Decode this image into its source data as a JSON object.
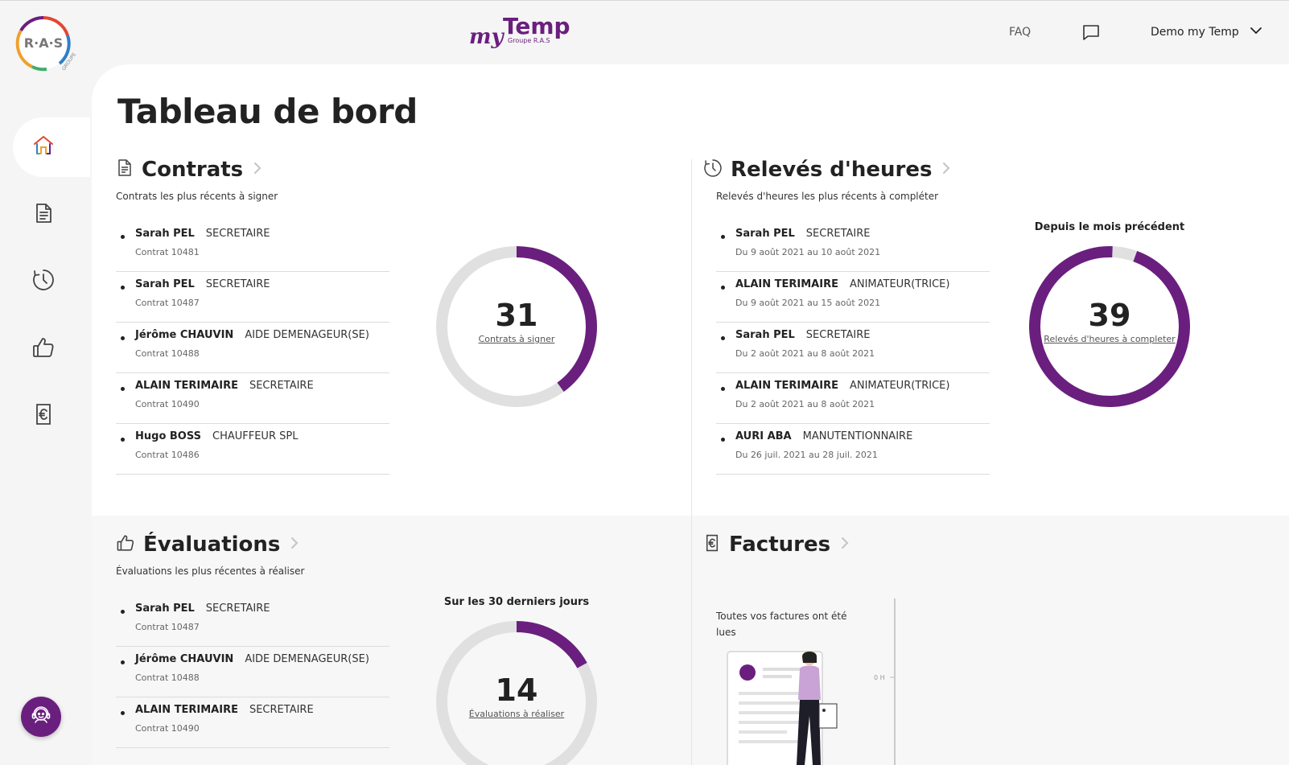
{
  "brand": {
    "logo_text": "R·A·S",
    "logo_sub": "GROUPE",
    "app_name_script": "my",
    "app_name": "Temp",
    "app_sub": "Groupe R.A.S"
  },
  "header": {
    "faq": "FAQ",
    "user": "Demo my Temp"
  },
  "page_title": "Tableau de bord",
  "contrats": {
    "title": "Contrats",
    "subtitle": "Contrats les plus récents à signer",
    "count": "31",
    "count_label": "Contrats à signer",
    "ratio": 0.4,
    "items": [
      {
        "name": "Sarah PEL",
        "job": "SECRETAIRE",
        "detail": "Contrat 10481"
      },
      {
        "name": "Sarah PEL",
        "job": "SECRETAIRE",
        "detail": "Contrat 10487"
      },
      {
        "name": "Jérôme CHAUVIN",
        "job": "AIDE DEMENAGEUR(SE)",
        "detail": "Contrat 10488"
      },
      {
        "name": "ALAIN TERIMAIRE",
        "job": "SECRETAIRE",
        "detail": "Contrat 10490"
      },
      {
        "name": "Hugo BOSS",
        "job": "CHAUFFEUR SPL",
        "detail": "Contrat 10486"
      }
    ]
  },
  "releves": {
    "title": "Relevés d'heures",
    "subtitle": "Relevés d'heures les plus récents à compléter",
    "caption": "Depuis le mois précédent",
    "count": "39",
    "count_label": "Relevés d'heures à completer",
    "ratio": 0.95,
    "items": [
      {
        "name": "Sarah PEL",
        "job": "SECRETAIRE",
        "detail": "Du 9 août 2021 au 10 août 2021"
      },
      {
        "name": "ALAIN TERIMAIRE",
        "job": "ANIMATEUR(TRICE)",
        "detail": "Du 9 août 2021 au 15 août 2021"
      },
      {
        "name": "Sarah PEL",
        "job": "SECRETAIRE",
        "detail": "Du 2 août 2021 au 8 août 2021"
      },
      {
        "name": "ALAIN TERIMAIRE",
        "job": "ANIMATEUR(TRICE)",
        "detail": "Du 2 août 2021 au 8 août 2021"
      },
      {
        "name": "AURI ABA",
        "job": "MANUTENTIONNAIRE",
        "detail": "Du 26 juil. 2021 au 28 juil. 2021"
      }
    ]
  },
  "evaluations": {
    "title": "Évaluations",
    "subtitle": "Évaluations les plus récentes à réaliser",
    "caption": "Sur les 30 derniers jours",
    "count": "14",
    "count_label": "Évaluations à réaliser",
    "ratio": 0.17,
    "items": [
      {
        "name": "Sarah PEL",
        "job": "SECRETAIRE",
        "detail": "Contrat 10487"
      },
      {
        "name": "Jérôme CHAUVIN",
        "job": "AIDE DEMENAGEUR(SE)",
        "detail": "Contrat 10488"
      },
      {
        "name": "ALAIN TERIMAIRE",
        "job": "SECRETAIRE",
        "detail": "Contrat 10490"
      }
    ]
  },
  "factures": {
    "title": "Factures",
    "message": "Toutes vos factures ont été lues",
    "axis_label": "0 H"
  },
  "colors": {
    "accent": "#6a1f7e",
    "track": "#e0e0e0"
  }
}
